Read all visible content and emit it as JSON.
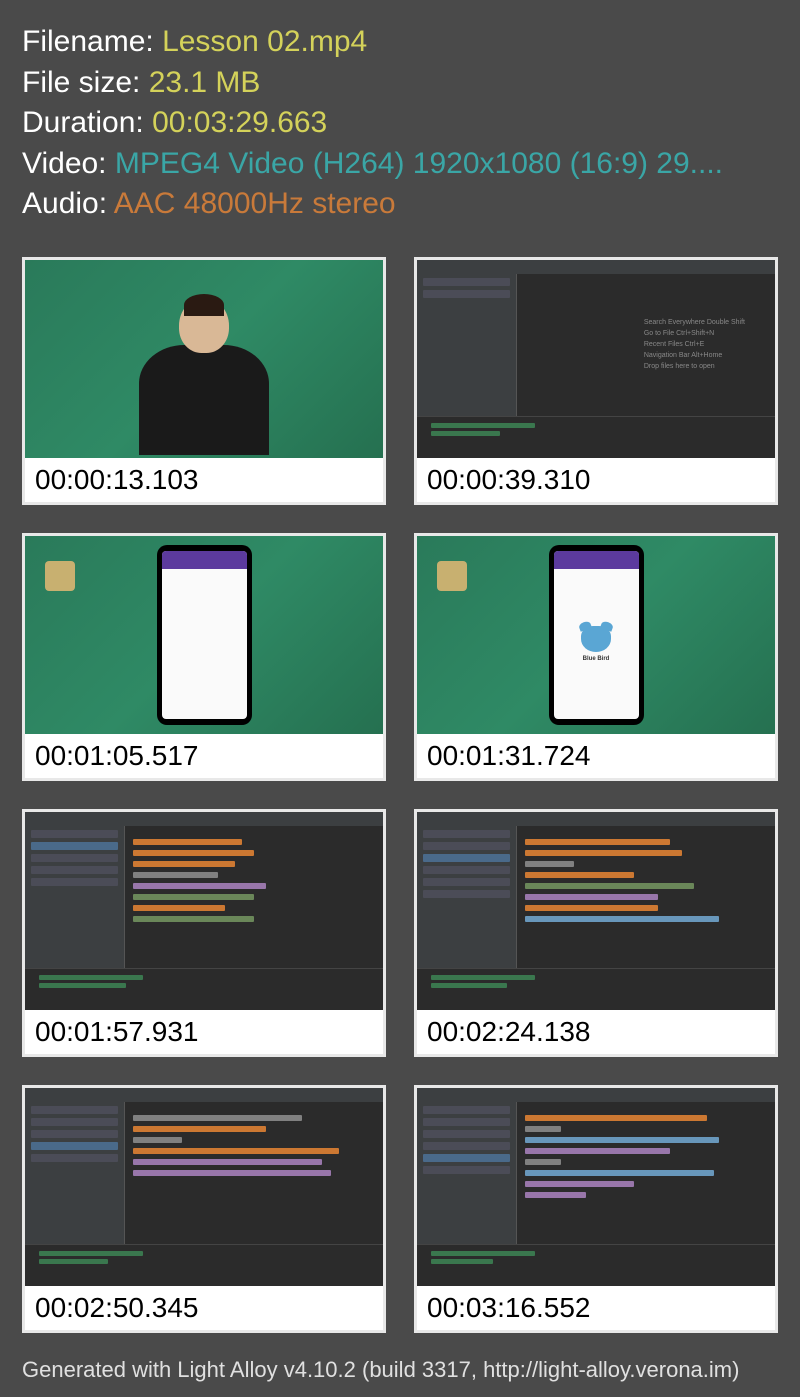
{
  "info": {
    "filename_label": "Filename: ",
    "filename_value": "Lesson 02.mp4",
    "filesize_label": "File size: ",
    "filesize_value": "23.1 MB",
    "duration_label": "Duration: ",
    "duration_value": "00:03:29.663",
    "video_label": "Video: ",
    "video_value": "MPEG4 Video (H264) 1920x1080 (16:9) 29....",
    "audio_label": "Audio: ",
    "audio_value": "AAC 48000Hz stereo"
  },
  "thumbs": {
    "t1": "00:00:13.103",
    "t2": "00:00:39.310",
    "t3": "00:01:05.517",
    "t4": "00:01:31.724",
    "t5": "00:01:57.931",
    "t6": "00:02:24.138",
    "t7": "00:02:50.345",
    "t8": "00:03:16.552"
  },
  "ide_hints": {
    "search": "Search Everywhere Double Shift",
    "goto": "Go to File Ctrl+Shift+N",
    "recent": "Recent Files Ctrl+E",
    "nav": "Navigation Bar Alt+Home",
    "drop": "Drop files here to open"
  },
  "phone": {
    "creature_name": "Blue Bird"
  },
  "footer": "Generated with Light Alloy v4.10.2 (build 3317, http://light-alloy.verona.im)"
}
